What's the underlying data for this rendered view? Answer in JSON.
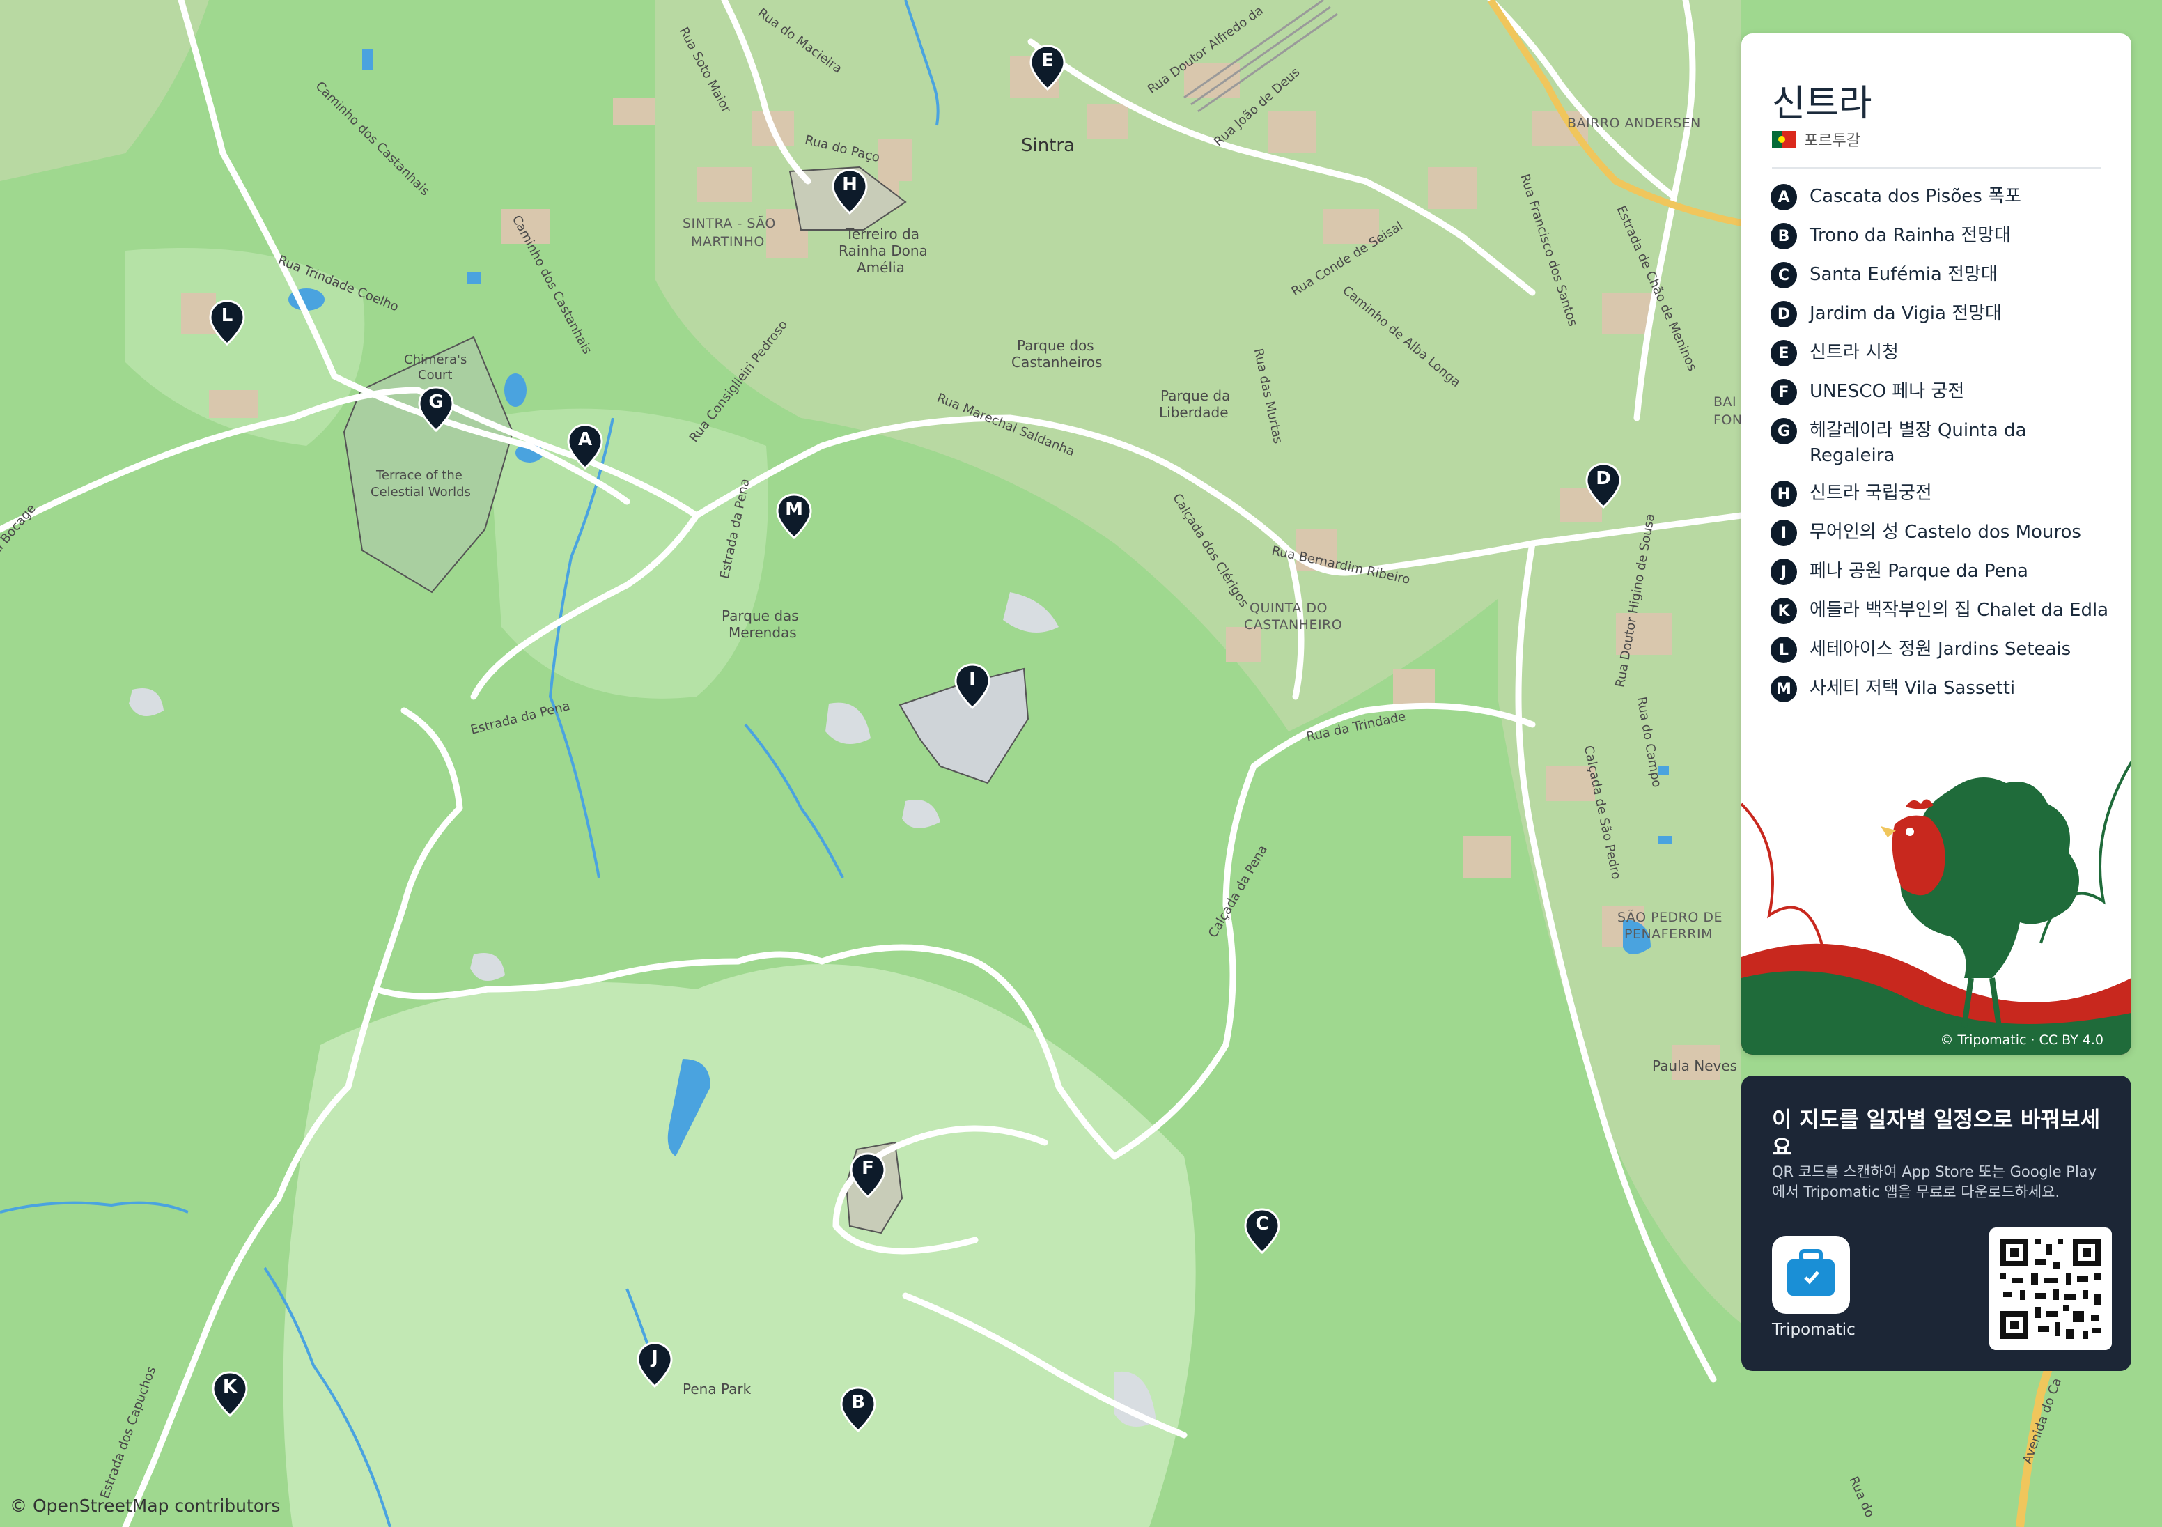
{
  "map": {
    "attribution": "© OpenStreetMap contributors",
    "labels": [
      {
        "id": "sintra",
        "text": "Sintra"
      },
      {
        "id": "sao-martinho-1",
        "text": "SINTRA - SÃO"
      },
      {
        "id": "sao-martinho-2",
        "text": "MARTINHO"
      },
      {
        "id": "terreiro-1",
        "text": "Terreiro da"
      },
      {
        "id": "terreiro-2",
        "text": "Rainha Dona"
      },
      {
        "id": "terreiro-3",
        "text": "Amélia"
      },
      {
        "id": "castanheiros-1",
        "text": "Parque dos"
      },
      {
        "id": "castanheiros-2",
        "text": "Castanheiros"
      },
      {
        "id": "liberdade-1",
        "text": "Parque da"
      },
      {
        "id": "liberdade-2",
        "text": "Liberdade"
      },
      {
        "id": "merendas-1",
        "text": "Parque das"
      },
      {
        "id": "merendas-2",
        "text": "Merendas"
      },
      {
        "id": "quinta-1",
        "text": "QUINTA DO"
      },
      {
        "id": "quinta-2",
        "text": "CASTANHEIRO"
      },
      {
        "id": "bairro",
        "text": "BAIRRO ANDERSEN"
      },
      {
        "id": "sao-pedro-1",
        "text": "SÃO PEDRO DE"
      },
      {
        "id": "sao-pedro-2",
        "text": "PENAFERRIM"
      },
      {
        "id": "chimera-1",
        "text": "Chimera's"
      },
      {
        "id": "chimera-2",
        "text": "Court"
      },
      {
        "id": "terrace-1",
        "text": "Terrace of the"
      },
      {
        "id": "terrace-2",
        "text": "Celestial Worlds"
      },
      {
        "id": "pena-park",
        "text": "Pena Park"
      },
      {
        "id": "paula-neves",
        "text": "Paula Neves"
      },
      {
        "id": "fon",
        "text": "FON"
      },
      {
        "id": "bai",
        "text": "BAI"
      },
      {
        "id": "r-soto-maior",
        "text": "Rua Soto Maior"
      },
      {
        "id": "r-macieira",
        "text": "Rua do Macieira"
      },
      {
        "id": "r-alfredo",
        "text": "Rua Doutor Alfredo da"
      },
      {
        "id": "r-joao-deus",
        "text": "Rua João de Deus"
      },
      {
        "id": "r-paco",
        "text": "Rua do Paço"
      },
      {
        "id": "cam-castanhais-1",
        "text": "Caminho dos Castanhais"
      },
      {
        "id": "cam-castanhais-2",
        "text": "Caminho dos Castanhais"
      },
      {
        "id": "r-trindade-coelho",
        "text": "Rua Trindade Coelho"
      },
      {
        "id": "r-consiglieri",
        "text": "Rua Consiglieiri Pedroso"
      },
      {
        "id": "r-marechal",
        "text": "Rua Marechal Saldanha"
      },
      {
        "id": "estr-pena-1",
        "text": "Estrada da Pena"
      },
      {
        "id": "estr-pena-2",
        "text": "Estrada da Pena"
      },
      {
        "id": "calc-clerigos",
        "text": "Calçada dos Clérigos"
      },
      {
        "id": "r-bernardim",
        "text": "Rua Bernardim Ribeiro"
      },
      {
        "id": "r-murtas",
        "text": "Rua das Murtas"
      },
      {
        "id": "r-conde-seisal",
        "text": "Rua Conde de Seisal"
      },
      {
        "id": "cam-alba",
        "text": "Caminho de Alba Longa"
      },
      {
        "id": "r-francisco",
        "text": "Rua Francisco dos Santos"
      },
      {
        "id": "estr-chao",
        "text": "Estrada de Chão de Meninos"
      },
      {
        "id": "r-trindade",
        "text": "Rua da Trindade"
      },
      {
        "id": "calc-pena",
        "text": "Calçada da Pena"
      },
      {
        "id": "r-higino",
        "text": "Rua Doutor Higino de Sousa"
      },
      {
        "id": "calc-sao-pedro",
        "text": "Calçada de São Pedro"
      },
      {
        "id": "r-campo",
        "text": "Rua do Campo"
      },
      {
        "id": "bocage",
        "text": "a Bocage"
      },
      {
        "id": "estr-capuchos",
        "text": "Estrada dos Capuchos"
      },
      {
        "id": "avenida",
        "text": "Avenida do Ca"
      },
      {
        "id": "rua-do",
        "text": "Rua do"
      }
    ],
    "markers": [
      {
        "letter": "A"
      },
      {
        "letter": "B"
      },
      {
        "letter": "C"
      },
      {
        "letter": "D"
      },
      {
        "letter": "E"
      },
      {
        "letter": "F"
      },
      {
        "letter": "G"
      },
      {
        "letter": "H"
      },
      {
        "letter": "I"
      },
      {
        "letter": "J"
      },
      {
        "letter": "K"
      },
      {
        "letter": "L"
      },
      {
        "letter": "M"
      }
    ],
    "colors": {
      "land": "#9fd88f",
      "park": "#c2e8b4",
      "water": "#4aa3df",
      "road": "#ffffff",
      "building": "#d9c7ad",
      "marker": "#0d1b2a"
    }
  },
  "legend": {
    "title": "신트라",
    "country": "포르투갈",
    "flag_icon": "portugal-flag-icon",
    "items": [
      {
        "letter": "A",
        "text": "Cascata dos Pisões 폭포"
      },
      {
        "letter": "B",
        "text": "Trono da Rainha 전망대"
      },
      {
        "letter": "C",
        "text": "Santa Eufémia 전망대"
      },
      {
        "letter": "D",
        "text": "Jardim da Vigia 전망대"
      },
      {
        "letter": "E",
        "text": "신트라 시청"
      },
      {
        "letter": "F",
        "text": "UNESCO 페나 궁전"
      },
      {
        "letter": "G",
        "text": "헤갈레이라 별장 Quinta da Regaleira"
      },
      {
        "letter": "H",
        "text": "신트라 국립궁전"
      },
      {
        "letter": "I",
        "text": "무어인의 성 Castelo dos Mouros"
      },
      {
        "letter": "J",
        "text": "페나 공원 Parque da Pena"
      },
      {
        "letter": "K",
        "text": "에들라 백작부인의 집 Chalet da Edla"
      },
      {
        "letter": "L",
        "text": "세테아이스 정원 Jardins Seteais"
      },
      {
        "letter": "M",
        "text": "사세티 저택 Vila Sassetti"
      }
    ],
    "art_icon": "rooster-illustration",
    "credit": "© Tripomatic · CC BY 4.0"
  },
  "promo": {
    "title": "이 지도를 일자별 일정으로 바꿔보세요",
    "text": "QR 코드를 스캔하여 App Store 또는 Google Play에서 Tripomatic 앱을 무료로 다운로드하세요.",
    "app_name": "Tripomatic",
    "app_icon": "suitcase-icon",
    "qr_icon": "qr-code-icon"
  }
}
